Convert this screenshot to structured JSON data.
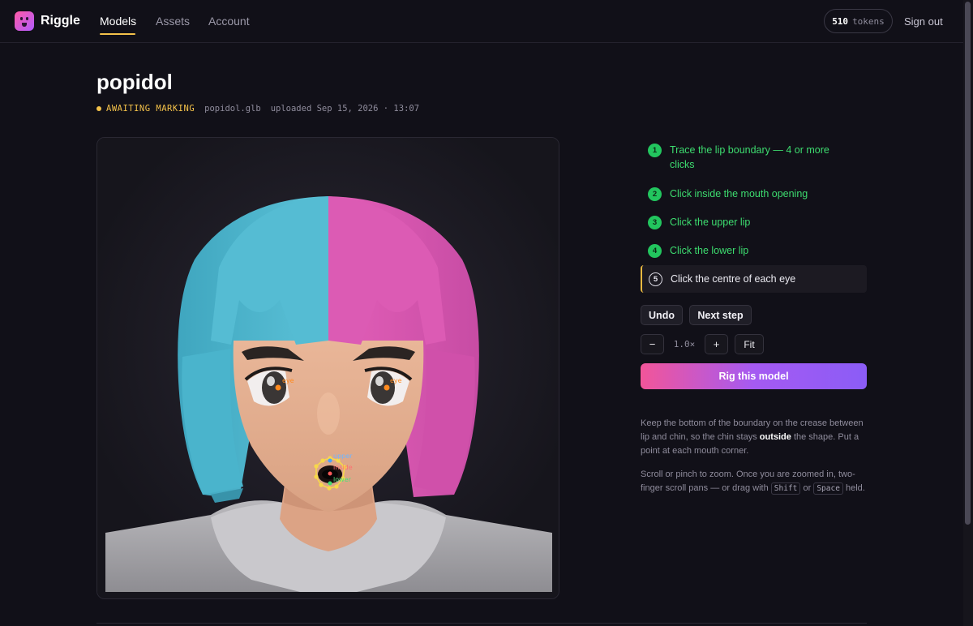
{
  "nav": {
    "brand": "Riggle",
    "links": [
      "Models",
      "Assets",
      "Account"
    ],
    "active": "Models",
    "tokens_value": "510",
    "tokens_unit": "tokens",
    "signout": "Sign out"
  },
  "model": {
    "name": "popidol",
    "status": "AWAITING MARKING",
    "filename": "popidol.glb",
    "uploaded": "uploaded Sep 15, 2026 · 13:07"
  },
  "viewer": {
    "markers": {
      "eye_left": "eye",
      "eye_right": "eye",
      "upper": "upper",
      "inside": "inside",
      "lower": "lower"
    }
  },
  "steps": [
    {
      "num": "1",
      "label": "Trace the lip boundary — 4 or more clicks",
      "state": "done"
    },
    {
      "num": "2",
      "label": "Click inside the mouth opening",
      "state": "done"
    },
    {
      "num": "3",
      "label": "Click the upper lip",
      "state": "done"
    },
    {
      "num": "4",
      "label": "Click the lower lip",
      "state": "done"
    },
    {
      "num": "5",
      "label": "Click the centre of each eye",
      "state": "current"
    }
  ],
  "controls": {
    "undo": "Undo",
    "next_step": "Next step",
    "zoom_out": "−",
    "zoom_level": "1.0×",
    "zoom_in": "+",
    "fit": "Fit",
    "rig": "Rig this model"
  },
  "hints": {
    "boundary_a": "Keep the bottom of the boundary on the crease between lip and chin, so the chin stays",
    "boundary_bold": "outside",
    "boundary_b": "the shape. Put a point at each mouth corner.",
    "zoom_a": "Scroll or pinch to zoom. Once you are zoomed in, two-finger scroll pans — or drag with",
    "key_shift": "Shift",
    "zoom_or": "or",
    "key_space": "Space",
    "zoom_b": "held."
  },
  "colors": {
    "accent_yellow": "#f4c24a",
    "done_green": "#22c55e",
    "hair_cyan": "#4fb8cf",
    "hair_pink": "#d957b0",
    "gradient_start": "#f25599",
    "gradient_end": "#8b5cf6"
  }
}
